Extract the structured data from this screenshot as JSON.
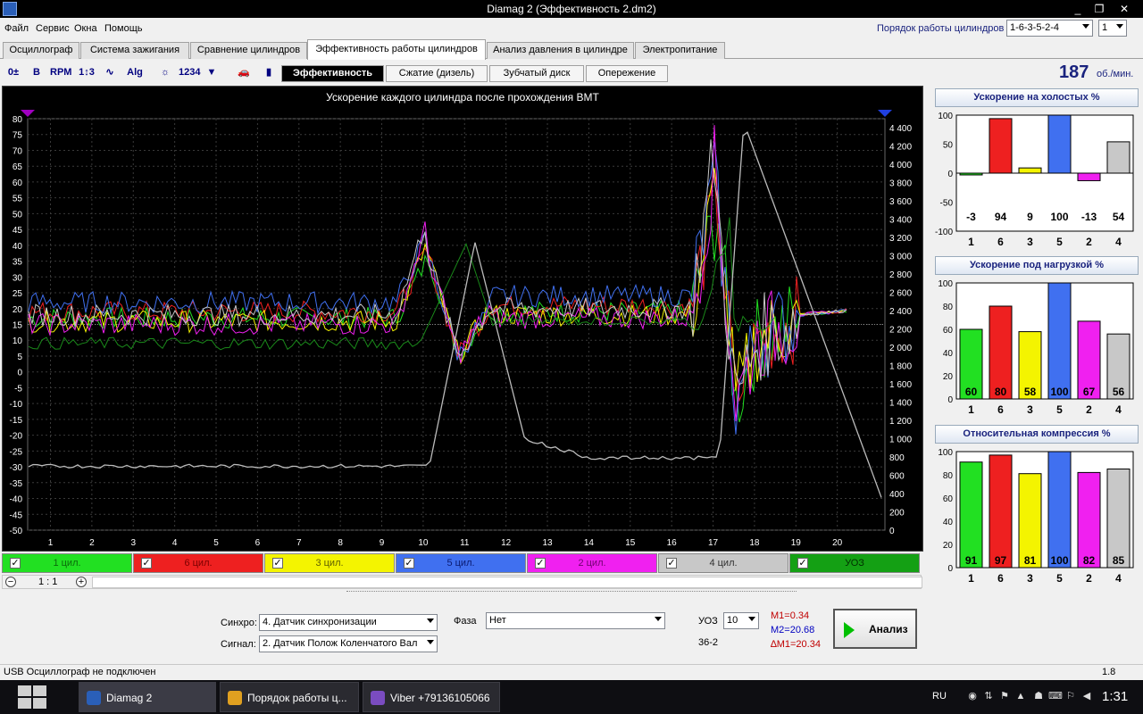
{
  "window": {
    "title": "Diamag 2 (Эффективность 2.dm2)",
    "minimize": "_",
    "maximize": "❐",
    "close": "✕"
  },
  "menu": [
    "Файл",
    "Сервис",
    "Окна",
    "Помощь"
  ],
  "cylinder_order": {
    "label": "Порядок работы цилиндров",
    "value": "1-6-3-5-2-4",
    "count": "1"
  },
  "tabs": [
    "Осциллограф",
    "Система зажигания",
    "Сравнение цилиндров",
    "Эффективность работы цилиндров",
    "Анализ давления в цилиндре",
    "Электропитание"
  ],
  "active_tab": 3,
  "toolbar_icons": [
    "adjust-icon",
    "bold-icon",
    "rpm-icon",
    "cylinder-numbers-icon",
    "waveform-icon",
    "alg-icon",
    "network-icon",
    "sequence-icon",
    "filter-icon",
    "car-icon",
    "chart-icon"
  ],
  "toolbar_icon_glyphs": [
    "0±",
    "B",
    "RPM",
    "1↕3",
    "∿",
    "Alg",
    "☼",
    "1234",
    "▼",
    "🚗",
    "▮"
  ],
  "subtabs": [
    "Эффективность",
    "Сжатие (дизель)",
    "Зубчатый диск",
    "Опережение"
  ],
  "active_subtab": 0,
  "rpm": {
    "value": "187",
    "unit": "об./мин."
  },
  "main_chart": {
    "title": "Ускорение каждого цилиндра после прохождения ВМТ",
    "left_ticks": [
      80,
      75,
      70,
      65,
      60,
      55,
      50,
      45,
      40,
      35,
      30,
      25,
      20,
      15,
      10,
      5,
      0,
      -5,
      -10,
      -15,
      -20,
      -25,
      -30,
      -35,
      -40,
      -45,
      -50
    ],
    "right_ticks": [
      "4 400",
      "4 200",
      "4 000",
      "3 800",
      "3 600",
      "3 400",
      "3 200",
      "3 000",
      "2 800",
      "2 600",
      "2 400",
      "2 200",
      "2 000",
      "1 800",
      "1 600",
      "1 400",
      "1 200",
      "1 000",
      "800",
      "600",
      "400",
      "200",
      "0"
    ],
    "x_ticks": [
      "1",
      "2",
      "3",
      "4",
      "5",
      "6",
      "7",
      "8",
      "9",
      "10",
      "11",
      "12",
      "13",
      "14",
      "15",
      "16",
      "17",
      "18",
      "19",
      "20"
    ]
  },
  "legend": [
    {
      "label": "1 цил.",
      "color": "#22e022",
      "text": "#0a6a0a"
    },
    {
      "label": "6 цил.",
      "color": "#ee2020",
      "text": "#7a0000"
    },
    {
      "label": "3 цил.",
      "color": "#f4f400",
      "text": "#606000"
    },
    {
      "label": "5 цил.",
      "color": "#4070f0",
      "text": "#0a1a70"
    },
    {
      "label": "2 цил.",
      "color": "#f020f0",
      "text": "#700070"
    },
    {
      "label": "4 цил.",
      "color": "#c8c8c8",
      "text": "#303030"
    },
    {
      "label": "УОЗ",
      "color": "#14a014",
      "text": "#003000"
    }
  ],
  "zoom": {
    "level": "1 : 1",
    "minus": "−",
    "plus": "+"
  },
  "controls": {
    "sync_label": "Синхро:",
    "sync_value": "4.  Датчик синхронизации",
    "signal_label": "Сигнал:",
    "signal_value": "2.  Датчик Полож Коленчатого Вал",
    "phase_label": "Фаза",
    "phase_value": "Нет",
    "uoz_label": "УОЗ",
    "uoz_value": "10",
    "teeth": "36-2",
    "m1": "M1=0.34",
    "m2": "M2=20.68",
    "dm1": "∆M1=20.34",
    "analyze": "Анализ"
  },
  "status": {
    "text": "USB Осциллограф не подключен",
    "version": "1.8"
  },
  "taskbar": {
    "items": [
      {
        "label": "Diamag 2",
        "color": "#2a5fb8"
      },
      {
        "label": "Порядок работы ц...",
        "color": "#e0a020"
      },
      {
        "label": "Viber +79136105066",
        "color": "#7a4cc0"
      }
    ],
    "lang": "RU",
    "time": "1:31"
  },
  "panels": [
    {
      "title": "Ускорение на холостых %",
      "ymin": -100,
      "ymax": 100,
      "ticks": [
        100,
        50,
        0,
        -50,
        -100
      ],
      "label_row": "bottom",
      "cylinders": [
        "1",
        "6",
        "3",
        "5",
        "2",
        "4"
      ],
      "values": [
        -3,
        94,
        9,
        100,
        -13,
        54
      ],
      "colors": [
        "#22e022",
        "#ee2020",
        "#f4f400",
        "#4070f0",
        "#f020f0",
        "#c8c8c8"
      ]
    },
    {
      "title": "Ускорение под нагрузкой %",
      "ymin": 0,
      "ymax": 100,
      "ticks": [
        100,
        80,
        60,
        40,
        20,
        0
      ],
      "label_row": "inside",
      "cylinders": [
        "1",
        "6",
        "3",
        "5",
        "2",
        "4"
      ],
      "values": [
        60,
        80,
        58,
        100,
        67,
        56
      ],
      "colors": [
        "#22e022",
        "#ee2020",
        "#f4f400",
        "#4070f0",
        "#f020f0",
        "#c8c8c8"
      ]
    },
    {
      "title": "Относительная компрессия %",
      "ymin": 0,
      "ymax": 100,
      "ticks": [
        100,
        80,
        60,
        40,
        20,
        0
      ],
      "label_row": "inside",
      "cylinders": [
        "1",
        "6",
        "3",
        "5",
        "2",
        "4"
      ],
      "values": [
        91,
        97,
        81,
        100,
        82,
        85
      ],
      "colors": [
        "#22e022",
        "#ee2020",
        "#f4f400",
        "#4070f0",
        "#f020f0",
        "#c8c8c8"
      ]
    }
  ]
}
